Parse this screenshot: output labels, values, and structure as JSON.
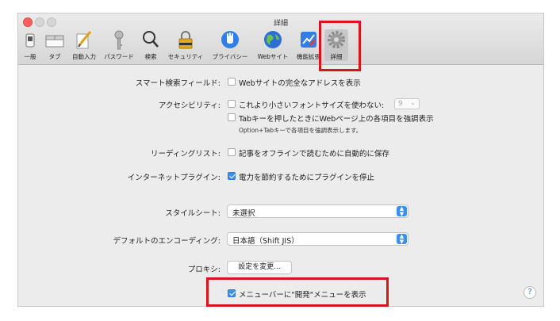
{
  "window": {
    "title": "詳細"
  },
  "toolbar": {
    "items": [
      {
        "label": "一般",
        "icon": "general-switch-icon"
      },
      {
        "label": "タブ",
        "icon": "tabs-icon"
      },
      {
        "label": "自動入力",
        "icon": "pencil-icon"
      },
      {
        "label": "パスワード",
        "icon": "key-icon"
      },
      {
        "label": "検索",
        "icon": "search-icon"
      },
      {
        "label": "セキュリティ",
        "icon": "padlock-icon"
      },
      {
        "label": "プライバシー",
        "icon": "hand-icon"
      },
      {
        "label": "Webサイト",
        "icon": "globe-icon"
      },
      {
        "label": "機能拡張",
        "icon": "extensions-icon"
      },
      {
        "label": "詳細",
        "icon": "gear-icon",
        "selected": true
      }
    ]
  },
  "settings": {
    "smart_search": {
      "label": "スマート検索フィールド:",
      "option": "Webサイトの完全なアドレスを表示",
      "checked": false
    },
    "accessibility": {
      "label": "アクセシビリティ:",
      "option1": "これより小さいフォントサイズを使わない:",
      "option1_checked": false,
      "font_size": "9",
      "option2": "Tabキーを押したときにWebページ上の各項目を強調表示",
      "option2_checked": false,
      "note": "Option+Tabキーで各項目を強調表示します。"
    },
    "reading_list": {
      "label": "リーディングリスト:",
      "option": "記事をオフラインで読むために自動的に保存",
      "checked": false
    },
    "internet_plugins": {
      "label": "インターネットプラグイン:",
      "option": "電力を節約するためにプラグインを停止",
      "checked": true
    },
    "style_sheet": {
      "label": "スタイルシート:",
      "value": "未選択"
    },
    "default_encoding": {
      "label": "デフォルトのエンコーディング:",
      "value": "日本語（Shift JIS）"
    },
    "proxies": {
      "label": "プロキシ:",
      "button": "設定を変更..."
    },
    "develop_menu": {
      "option": "メニューバーに\"開発\"メニューを表示",
      "checked": true
    }
  },
  "help": {
    "label": "?"
  },
  "colors": {
    "highlight": "#d8151f",
    "accent": "#3b8ef0"
  }
}
